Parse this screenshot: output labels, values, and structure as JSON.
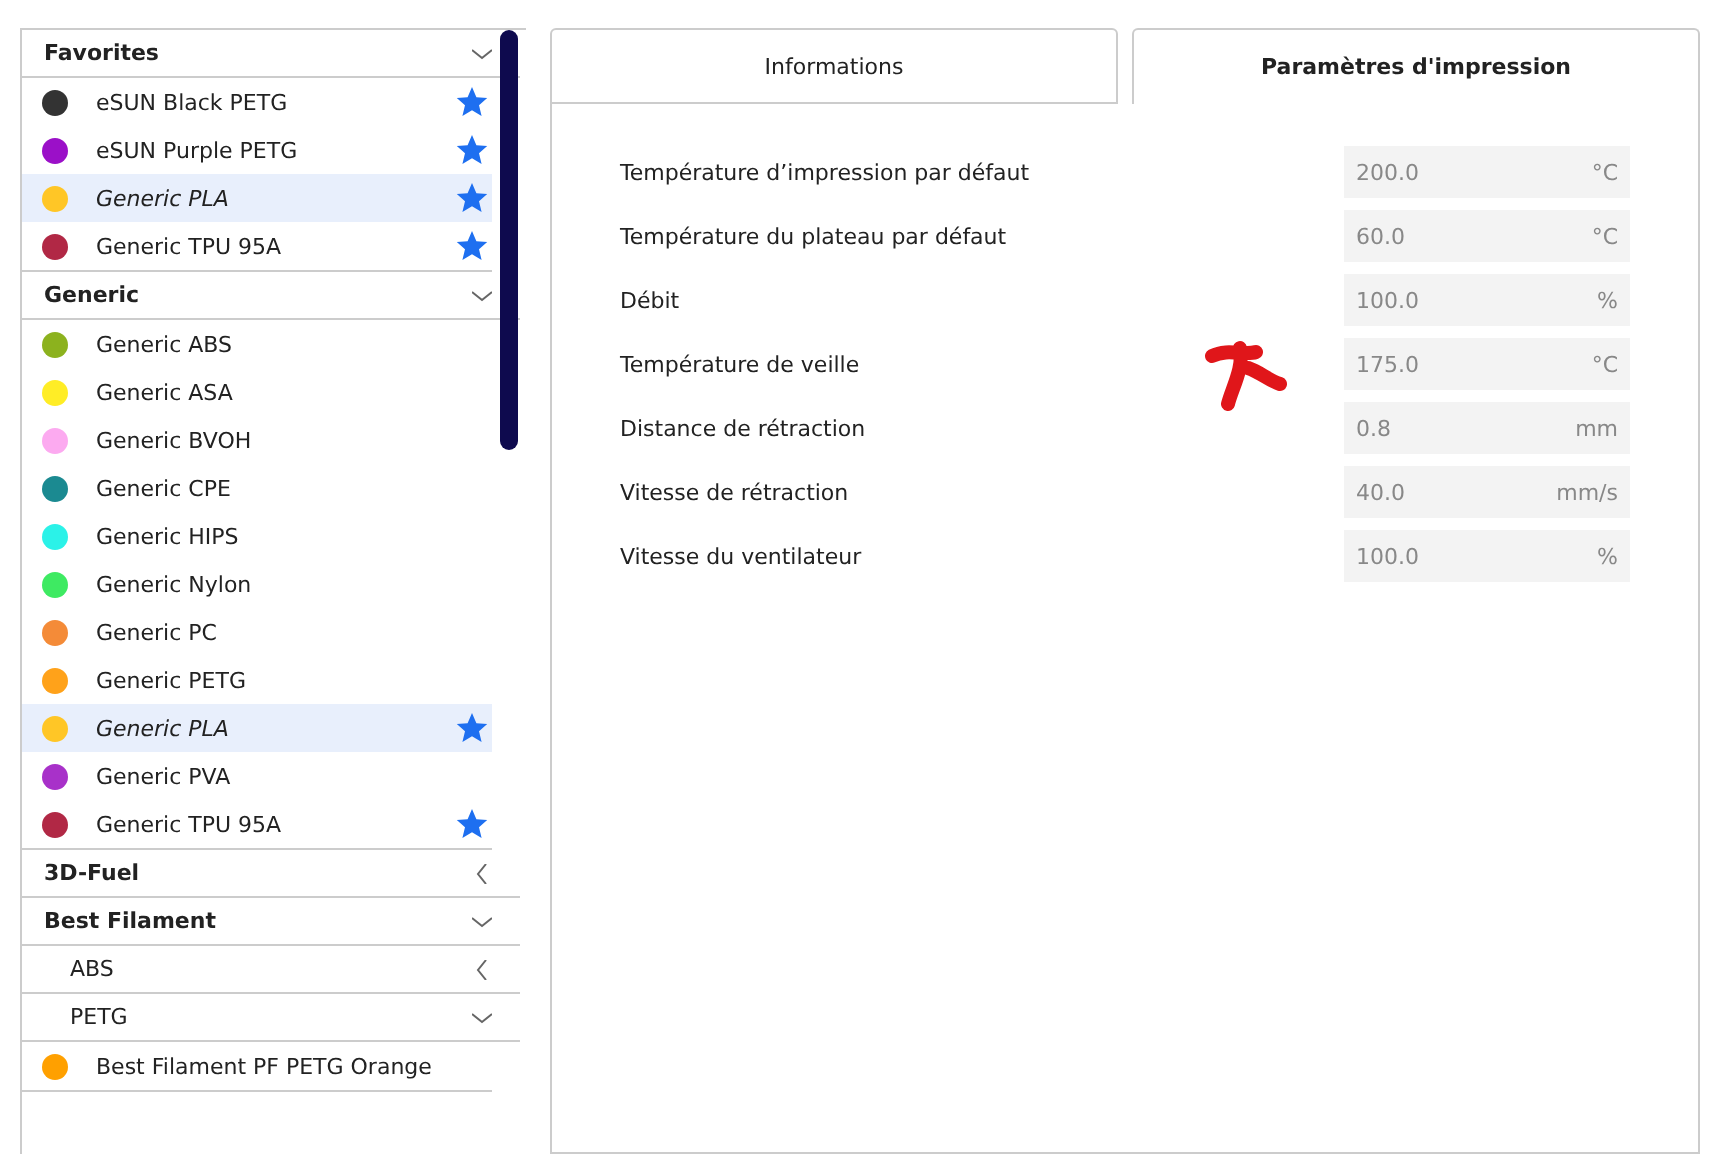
{
  "materials": [
    {
      "label": "Favorites",
      "expanded": true,
      "children": [
        {
          "name": "eSUN Black PETG",
          "color": "#333333",
          "favorite": true,
          "selected": false
        },
        {
          "name": "eSUN Purple PETG",
          "color": "#9b10c8",
          "favorite": true,
          "selected": false
        },
        {
          "name": "Generic PLA",
          "color": "#ffc626",
          "favorite": true,
          "selected": true
        },
        {
          "name": "Generic TPU 95A",
          "color": "#b12845",
          "favorite": true,
          "selected": false
        }
      ]
    },
    {
      "label": "Generic",
      "expanded": true,
      "children": [
        {
          "name": "Generic ABS",
          "color": "#8cb21e",
          "favorite": false,
          "selected": false
        },
        {
          "name": "Generic ASA",
          "color": "#ffed26",
          "favorite": false,
          "selected": false
        },
        {
          "name": "Generic BVOH",
          "color": "#fcaaf0",
          "favorite": false,
          "selected": false
        },
        {
          "name": "Generic CPE",
          "color": "#1b8a91",
          "favorite": false,
          "selected": false
        },
        {
          "name": "Generic HIPS",
          "color": "#2bf2e8",
          "favorite": false,
          "selected": false
        },
        {
          "name": "Generic Nylon",
          "color": "#3eea62",
          "favorite": false,
          "selected": false
        },
        {
          "name": "Generic PC",
          "color": "#f48b38",
          "favorite": false,
          "selected": false
        },
        {
          "name": "Generic PETG",
          "color": "#ffa21a",
          "favorite": false,
          "selected": false
        },
        {
          "name": "Generic PLA",
          "color": "#ffc626",
          "favorite": true,
          "selected": true
        },
        {
          "name": "Generic PVA",
          "color": "#a831c9",
          "favorite": false,
          "selected": false
        },
        {
          "name": "Generic TPU 95A",
          "color": "#b12845",
          "favorite": true,
          "selected": false
        }
      ]
    },
    {
      "label": "3D-Fuel",
      "expanded": false
    },
    {
      "label": "Best Filament",
      "expanded": true,
      "children": [
        {
          "label": "ABS",
          "expanded": false
        },
        {
          "label": "PETG",
          "expanded": true,
          "children": [
            {
              "name": "Best Filament PF PETG Orange",
              "color": "#ffa000",
              "favorite": false,
              "selected": false
            }
          ]
        }
      ]
    }
  ],
  "tabs": [
    {
      "label": "Informations",
      "selected": false
    },
    {
      "label": "Paramètres d'impression",
      "selected": true
    }
  ],
  "settings": [
    {
      "label": "Température d’impression par défaut",
      "value": "200.0",
      "unit": "°C"
    },
    {
      "label": "Température du plateau par défaut",
      "value": "60.0",
      "unit": "°C"
    },
    {
      "label": "Débit",
      "value": "100.0",
      "unit": "%"
    },
    {
      "label": "Température de veille",
      "value": "175.0",
      "unit": "°C"
    },
    {
      "label": "Distance de rétraction",
      "value": "0.8",
      "unit": "mm"
    },
    {
      "label": "Vitesse de rétraction",
      "value": "40.0",
      "unit": "mm/s"
    },
    {
      "label": "Vitesse du ventilateur",
      "value": "100.0",
      "unit": "%"
    }
  ]
}
